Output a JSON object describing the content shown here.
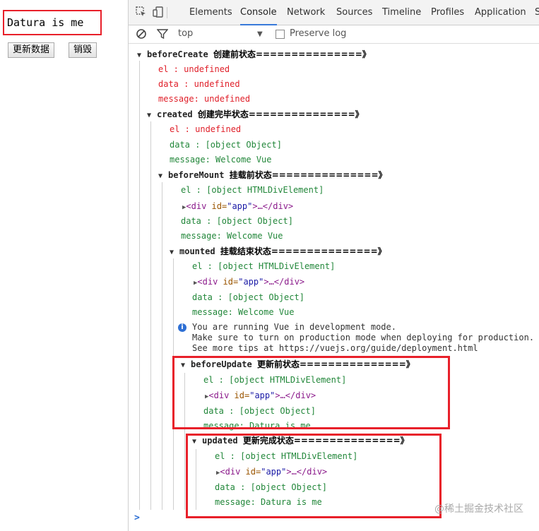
{
  "page": {
    "text": "Datura is me",
    "update_button": "更新数据",
    "destroy_button": "销毁"
  },
  "devtools": {
    "tabs": [
      "Elements",
      "Console",
      "Network",
      "Sources",
      "Timeline",
      "Profiles",
      "Application",
      "S"
    ],
    "active_tab": "Console",
    "context": "top",
    "preserve_log": "Preserve log"
  },
  "console": {
    "before_create": {
      "name": "beforeCreate",
      "label": "创建前状态===============》",
      "el": "el     : undefined",
      "data": "data   : undefined",
      "message": "message: undefined"
    },
    "created": {
      "name": "created",
      "label": "创建完毕状态===============》",
      "el": "el     : undefined",
      "data": "data   : [object Object]",
      "message": "message: Welcome Vue"
    },
    "before_mount": {
      "name": "beforeMount",
      "label": "挂载前状态===============》",
      "el": "el     : [object HTMLDivElement]",
      "node_tag_open": "<div ",
      "node_attr": "id=",
      "node_val": "\"app\"",
      "node_rest": ">…</div>",
      "data": "data   : [object Object]",
      "message": "message: Welcome Vue"
    },
    "mounted": {
      "name": "mounted",
      "label": "挂载结束状态===============》",
      "el": "el     : [object HTMLDivElement]",
      "node_tag_open": "<div ",
      "node_attr": "id=",
      "node_val": "\"app\"",
      "node_rest": ">…</div>",
      "data": "data   : [object Object]",
      "message": "message: Welcome Vue"
    },
    "info": "You are running Vue in development mode.\nMake sure to turn on production mode when deploying for production.\nSee more tips at https://vuejs.org/guide/deployment.html",
    "before_update": {
      "name": "beforeUpdate",
      "label": "更新前状态===============》",
      "el": "el     : [object HTMLDivElement]",
      "node_tag_open": "<div ",
      "node_attr": "id=",
      "node_val": "\"app\"",
      "node_rest": ">…</div>",
      "data": "data   : [object Object]",
      "message": "message: Datura is me"
    },
    "updated": {
      "name": "updated",
      "label": "更新完成状态===============》",
      "el": "el     : [object HTMLDivElement]",
      "node_tag_open": "<div ",
      "node_attr": "id=",
      "node_val": "\"app\"",
      "node_rest": ">…</div>",
      "data": "data   : [object Object]",
      "message": "message: Datura is me"
    },
    "prompt": ">"
  },
  "watermark": "@稀土掘金技术社区",
  "colors": {
    "highlight": "#e8202a",
    "undefined_text": "#e0202a",
    "defined_text": "#22873a",
    "active_tab": "#3879d9"
  }
}
